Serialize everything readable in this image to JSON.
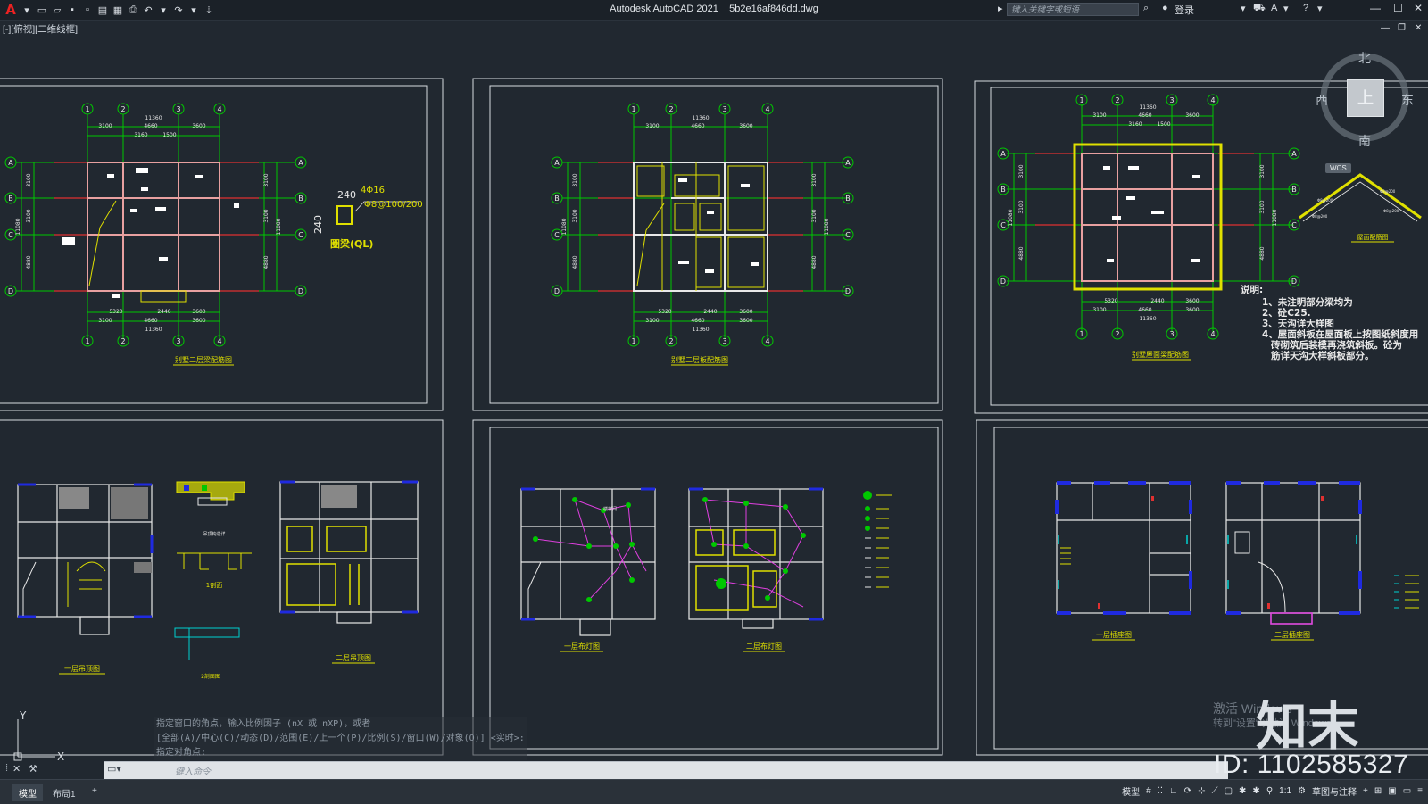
{
  "app": {
    "title": "Autodesk AutoCAD 2021",
    "filename": "5b2e16af846dd.dwg",
    "logo": "A",
    "search_placeholder": "键入关键字或短语",
    "login": "登录",
    "viewport_label": "[-][俯视][二维线框]"
  },
  "compass": {
    "north": "北",
    "south": "南",
    "west": "西",
    "east": "东",
    "top": "上",
    "wcs": "WCS"
  },
  "command_history": [
    "指定窗口的角点，输入比例因子 (nX 或 nXP)，或者",
    "[全部(A)/中心(C)/动态(D)/范围(E)/上一个(P)/比例(S)/窗口(W)/对象(O)] <实时>:",
    "指定对角点:"
  ],
  "command_input_placeholder": "键入命令",
  "layout_tabs": [
    "模型",
    "布局1",
    "+"
  ],
  "status_items": [
    "模型",
    "1:1",
    "草图与注释"
  ],
  "watermark": {
    "activate_line1": "激活 Windows",
    "activate_line2": "转到\"设置\"以激活 Windows。",
    "logo": "知末",
    "id": "ID: 1102585327"
  },
  "sheets": {
    "s1": {
      "title": "别墅二层梁配筋图",
      "dims_top_total": "11360",
      "dims_top": [
        "3100",
        "4660",
        "3600"
      ],
      "dims_top_inner": [
        "3160",
        "1500"
      ],
      "dims_bottom": [
        "5320",
        "2440",
        "3600"
      ],
      "dims_bottom2": [
        "3100",
        "4660",
        "3600"
      ],
      "dims_bottom_total": "11360",
      "dims_side": [
        "3100",
        "3100",
        "4880"
      ],
      "dims_side_total": "11080",
      "axes_num": [
        "1",
        "2",
        "3",
        "4"
      ],
      "axes_let": [
        "A",
        "B",
        "C",
        "D"
      ],
      "ring_beam": "圈梁(QL)",
      "ring_beam_rebar": "4Φ16",
      "ring_beam_stirrup": "Φ8@100/200",
      "ring_beam_size": "240"
    },
    "s2": {
      "title": "别墅二层板配筋图",
      "dims_top_total": "11360",
      "dims_top": [
        "3100",
        "4660",
        "3600"
      ],
      "dims_bottom": [
        "5320",
        "2440",
        "3600"
      ],
      "dims_bottom2": [
        "3100",
        "4660",
        "3600"
      ],
      "dims_bottom_total": "11360",
      "dims_side": [
        "3100",
        "3100",
        "4880"
      ],
      "dims_side_total": "11080"
    },
    "s3": {
      "title": "别墅屋面梁配筋图",
      "roof_title": "屋面配筋图",
      "notes_title": "说明:",
      "notes": [
        "1、未注明部分梁均为",
        "2、砼C25.",
        "3、天沟详大样图",
        "4、屋面斜板在屋面板上按图纸斜度用",
        "   砖砌筑后装模再浇筑斜板。砼为",
        "   筋详天沟大样斜板部分。"
      ],
      "dims_top_total": "11360",
      "dims_top": [
        "3100",
        "4660",
        "3600"
      ],
      "dims_top_inner": [
        "3160",
        "1500"
      ],
      "dims_bottom": [
        "5320",
        "2440",
        "3600"
      ],
      "dims_bottom2": [
        "3100",
        "4660",
        "3600"
      ],
      "dims_bottom_total": "11360",
      "dims_side": [
        "3100",
        "3100",
        "4880"
      ],
      "dims_side_total": "11080"
    },
    "s4": {
      "left_title": "一层吊顶图",
      "right_title": "二层吊顶图",
      "detail_title": "1剖面",
      "detail2_title": "2剖面图",
      "detail_note": "吊顶构造详"
    },
    "s5": {
      "left_title": "一层布灯图",
      "right_title": "二层布灯图",
      "stair_label": "楼梯间"
    },
    "s6": {
      "left_title": "一层插座图",
      "right_title": "二层插座图"
    }
  },
  "colors": {
    "background": "#212830",
    "frame": "#d7dce1",
    "wall": "#e8e8e8",
    "axis": "#00c800",
    "axis_red": "#e03030",
    "beam": "#e0e000",
    "light": "#e040e0",
    "outlet": "#2030e0",
    "accent_outlet": "#00d0d0"
  }
}
